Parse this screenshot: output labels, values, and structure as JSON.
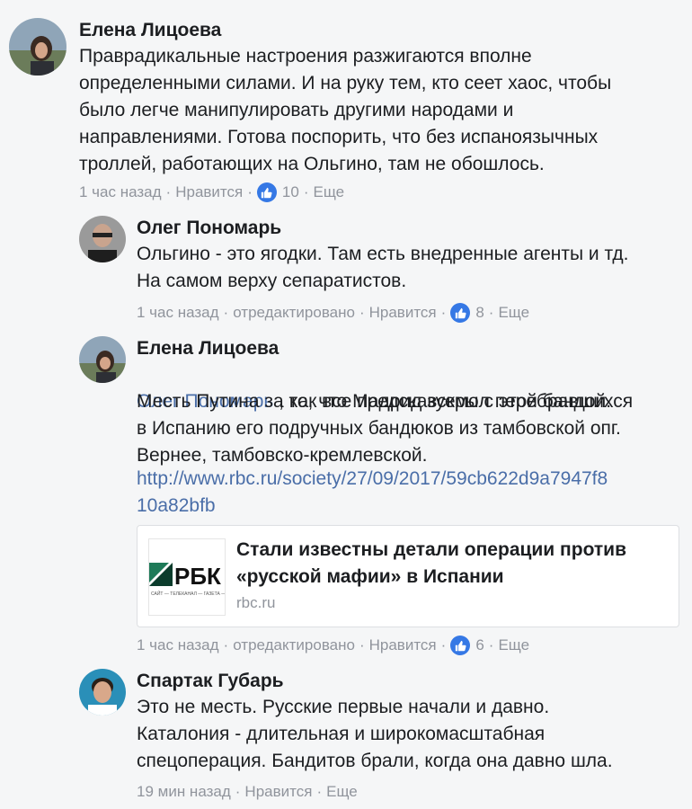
{
  "comments": [
    {
      "author": "Елена Лицоева",
      "text": "Праврадикальные настроения разжигаются вполне\nопределенными силами. И на руку тем, кто сеет хаос, чтобы\nбыло легче манипулировать другими народами и\nнаправлениями. Готова поспорить, что без испаноязычных\nтроллей, работающих на Ольгино, там не обошлось.",
      "time": "1 час назад",
      "like_label": "Нравится",
      "likes": "10",
      "more_label": "Еще"
    },
    {
      "author": "Олег Пономарь",
      "text": "Ольгино - это ягодки. Там есть внедренные агенты и тд.\nНа самом верху сепаратистов.",
      "time": "1 час назад",
      "edited_label": "отредактировано",
      "like_label": "Нравится",
      "likes": "8",
      "more_label": "Еще"
    },
    {
      "author": "Елена Лицоева",
      "mention": "Олег Пономарь",
      "text_after_mention": " , как все предсказуемо с этой бандой.",
      "text": "Месть Путина за то, что Мадрид вскрыл перебравшихся\nв Испанию его подручных бандюков из тамбовской опг.\nВернее, тамбовско-кремлевской.",
      "url": "http://www.rbc.ru/society/27/09/2017/59cb622d9a7947f8\n10a82bfb",
      "link_card": {
        "title": "Стали известны детали операции против\n«русской мафии» в Испании",
        "domain": "rbc.ru",
        "logo_text": "РБК",
        "logo_subtext": "САЙТ — ТЕЛЕКАНАЛ — ГАЗЕТА — ЖУРНАЛ"
      },
      "time": "1 час назад",
      "edited_label": "отредактировано",
      "like_label": "Нравится",
      "likes": "6",
      "more_label": "Еще"
    },
    {
      "author": "Спартак Губарь",
      "text": "Это не месть. Русские первые начали и давно.\nКаталония - длительная и широкомасштабная\nспецоперация. Бандитов брали, когда она давно шла.",
      "time": "19 мин назад",
      "like_label": "Нравится",
      "more_label": "Еще"
    }
  ],
  "colors": {
    "background": "#f5f6f7",
    "link": "#4a6ea8",
    "meta": "#90949c",
    "like_badge": "#3578e5"
  },
  "icons": {
    "like": "thumbs-up-icon"
  }
}
